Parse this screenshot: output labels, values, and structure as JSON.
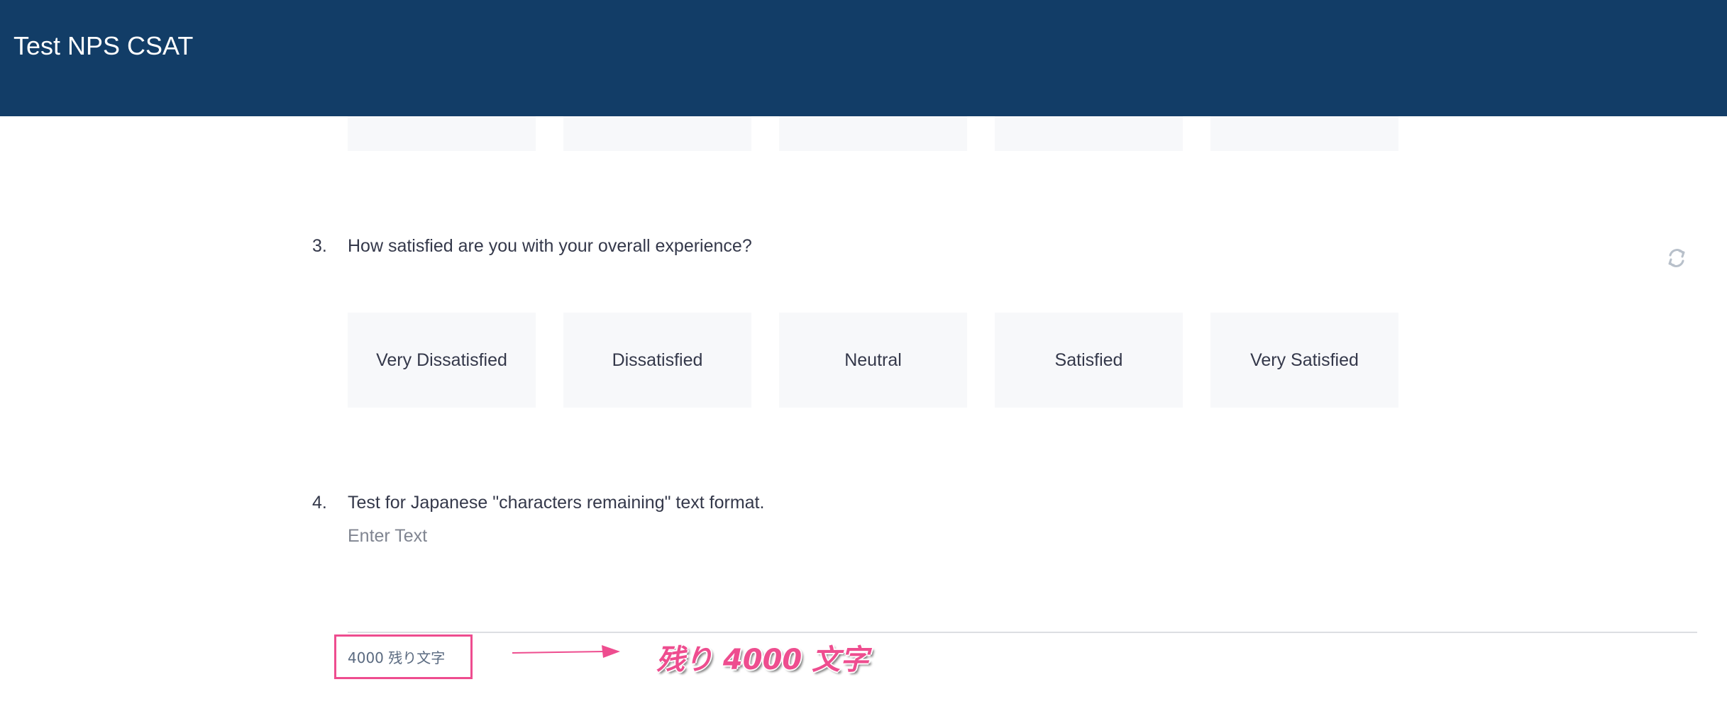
{
  "header": {
    "title": "Test NPS CSAT"
  },
  "questions": [
    {
      "number": "3.",
      "text": "How satisfied are you with your overall experience?",
      "options": [
        "Very Dissatisfied",
        "Dissatisfied",
        "Neutral",
        "Satisfied",
        "Very Satisfied"
      ]
    },
    {
      "number": "4.",
      "text": "Test for Japanese \"characters remaining\" text format.",
      "placeholder": "Enter Text",
      "counter": "4000 残り文字"
    }
  ],
  "annotation": {
    "text": "残り 4000 文字"
  },
  "icons": {
    "refresh": "refresh-icon",
    "arrow": "arrow-right-icon"
  },
  "colors": {
    "header_bg": "#123d67",
    "option_bg": "#f7f8fa",
    "annotation": "#ee4d8f"
  }
}
